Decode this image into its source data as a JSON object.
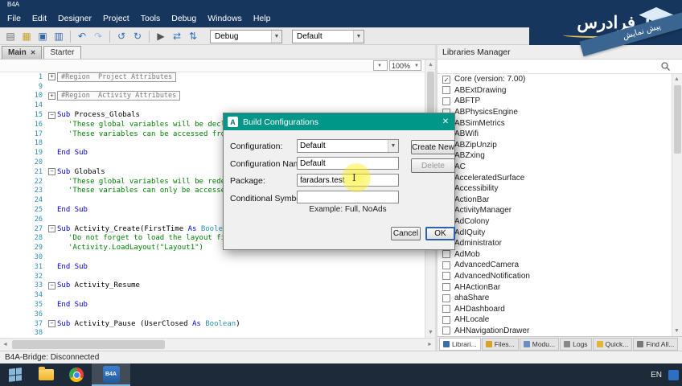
{
  "window": {
    "title": "B4A"
  },
  "menu_bar": {
    "items": [
      "File",
      "Edit",
      "Designer",
      "Project",
      "Tools",
      "Debug",
      "Windows",
      "Help"
    ]
  },
  "toolbar": {
    "build_mode_value": "Debug",
    "config_value": "Default",
    "icons": [
      {
        "name": "new-file-icon",
        "glyph": "▤",
        "color": "#707070"
      },
      {
        "name": "open-project-icon",
        "glyph": "▦",
        "color": "#c9a227"
      },
      {
        "name": "save-icon",
        "glyph": "▣",
        "color": "#3465a4"
      },
      {
        "name": "save-all-icon",
        "glyph": "▥",
        "color": "#3465a4"
      },
      {
        "name": "sep"
      },
      {
        "name": "undo-icon",
        "glyph": "↶",
        "color": "#2e6fb8"
      },
      {
        "name": "redo-icon",
        "glyph": "↷",
        "color": "#9fb8d8"
      },
      {
        "name": "sep"
      },
      {
        "name": "navigate-back-icon",
        "glyph": "↺",
        "color": "#2e6fb8"
      },
      {
        "name": "navigate-forward-icon",
        "glyph": "↻",
        "color": "#2e6fb8"
      },
      {
        "name": "sep"
      },
      {
        "name": "run-icon",
        "glyph": "▶",
        "color": "#555555"
      },
      {
        "name": "compile-icon",
        "glyph": "⇄",
        "color": "#2e6fb8"
      },
      {
        "name": "connect-device-icon",
        "glyph": "⇅",
        "color": "#2e6fb8"
      }
    ]
  },
  "editor_tabs": {
    "tabs": [
      {
        "label": "Main",
        "active": true,
        "closable": true
      },
      {
        "label": "Starter",
        "active": false,
        "closable": false
      }
    ]
  },
  "editor": {
    "zoom_value": "100%",
    "lines": [
      {
        "num": "1",
        "type": "region",
        "fold": "plus",
        "text": "#Region  Project Attributes"
      },
      {
        "num": "9",
        "type": "blank"
      },
      {
        "num": "10",
        "type": "region",
        "fold": "plus",
        "text": "#Region  Activity Attributes"
      },
      {
        "num": "14",
        "type": "blank"
      },
      {
        "num": "15",
        "fold": "minus",
        "segments": [
          {
            "t": "Sub",
            "c": "kw"
          },
          {
            "t": " Process_Globals",
            "c": "plain"
          }
        ]
      },
      {
        "num": "16",
        "indent": 1,
        "segments": [
          {
            "t": "'These global variables will be declared once when the application starts.",
            "c": "comment"
          }
        ]
      },
      {
        "num": "17",
        "indent": 1,
        "segments": [
          {
            "t": "'These variables can be accessed from all modules.",
            "c": "comment"
          }
        ]
      },
      {
        "num": "18",
        "type": "blank"
      },
      {
        "num": "19",
        "segments": [
          {
            "t": "End Sub",
            "c": "kw"
          }
        ]
      },
      {
        "num": "20",
        "type": "blank"
      },
      {
        "num": "21",
        "fold": "minus",
        "segments": [
          {
            "t": "Sub",
            "c": "kw"
          },
          {
            "t": " Globals",
            "c": "plain"
          }
        ]
      },
      {
        "num": "22",
        "indent": 1,
        "segments": [
          {
            "t": "'These global variables will be redeclared each time the activity is created.",
            "c": "comment"
          }
        ]
      },
      {
        "num": "23",
        "indent": 1,
        "segments": [
          {
            "t": "'These variables can only be accessed from this module.",
            "c": "comment"
          }
        ]
      },
      {
        "num": "24",
        "type": "blank"
      },
      {
        "num": "25",
        "segments": [
          {
            "t": "End Sub",
            "c": "kw"
          }
        ]
      },
      {
        "num": "26",
        "type": "blank"
      },
      {
        "num": "27",
        "fold": "minus",
        "segments": [
          {
            "t": "Sub",
            "c": "kw"
          },
          {
            "t": " Activity_Create(FirstTime ",
            "c": "plain"
          },
          {
            "t": "As",
            "c": "kw"
          },
          {
            "t": " ",
            "c": "plain"
          },
          {
            "t": "Boolean",
            "c": "type"
          },
          {
            "t": ")",
            "c": "plain"
          }
        ]
      },
      {
        "num": "28",
        "indent": 1,
        "segments": [
          {
            "t": "'Do not forget to load the layout file created with the visual designer. For example:",
            "c": "comment"
          }
        ]
      },
      {
        "num": "29",
        "indent": 1,
        "segments": [
          {
            "t": "'Activity.LoadLayout(\"Layout1\")",
            "c": "comment"
          }
        ]
      },
      {
        "num": "30",
        "type": "blank"
      },
      {
        "num": "31",
        "segments": [
          {
            "t": "End Sub",
            "c": "kw"
          }
        ]
      },
      {
        "num": "32",
        "type": "blank"
      },
      {
        "num": "33",
        "fold": "minus",
        "segments": [
          {
            "t": "Sub",
            "c": "kw"
          },
          {
            "t": " Activity_Resume",
            "c": "plain"
          }
        ]
      },
      {
        "num": "34",
        "type": "blank"
      },
      {
        "num": "35",
        "segments": [
          {
            "t": "End Sub",
            "c": "kw"
          }
        ]
      },
      {
        "num": "36",
        "type": "blank"
      },
      {
        "num": "37",
        "fold": "minus",
        "segments": [
          {
            "t": "Sub",
            "c": "kw"
          },
          {
            "t": " Activity_Pause (UserClosed ",
            "c": "plain"
          },
          {
            "t": "As",
            "c": "kw"
          },
          {
            "t": " ",
            "c": "plain"
          },
          {
            "t": "Boolean",
            "c": "type"
          },
          {
            "t": ")",
            "c": "plain"
          }
        ]
      },
      {
        "num": "38",
        "type": "blank"
      }
    ]
  },
  "dialog": {
    "title": "Build Configurations",
    "app_icon_letter": "A",
    "fields": {
      "configuration_label": "Configuration:",
      "configuration_value": "Default",
      "configuration_name_label": "Configuration Name:",
      "configuration_name_value": "Default",
      "package_label": "Package:",
      "package_value": "faradars.test",
      "conditional_symbols_label": "Conditional Symbols:",
      "conditional_symbols_value": "",
      "example_text": "Example: Full, NoAds"
    },
    "buttons": {
      "create_new": "Create New",
      "delete": "Delete",
      "cancel": "Cancel",
      "ok": "OK"
    }
  },
  "libraries_panel": {
    "title": "Libraries Manager",
    "items": [
      {
        "label": "Core (version: 7.00)",
        "checked": true
      },
      {
        "label": "ABExtDrawing",
        "checked": false
      },
      {
        "label": "ABFTP",
        "checked": false
      },
      {
        "label": "ABPhysicsEngine",
        "checked": false
      },
      {
        "label": "ABSimMetrics",
        "checked": false
      },
      {
        "label": "ABWifi",
        "checked": false
      },
      {
        "label": "ABZipUnzip",
        "checked": false
      },
      {
        "label": "ABZxing",
        "checked": false
      },
      {
        "label": "AC",
        "checked": false
      },
      {
        "label": "AcceleratedSurface",
        "checked": false
      },
      {
        "label": "Accessibility",
        "checked": false
      },
      {
        "label": "ActionBar",
        "checked": false
      },
      {
        "label": "ActivityManager",
        "checked": false
      },
      {
        "label": "AdColony",
        "checked": false
      },
      {
        "label": "AdIQuity",
        "checked": false
      },
      {
        "label": "Administrator",
        "checked": false
      },
      {
        "label": "AdMob",
        "checked": false
      },
      {
        "label": "AdvancedCamera",
        "checked": false
      },
      {
        "label": "AdvancedNotification",
        "checked": false
      },
      {
        "label": "AHActionBar",
        "checked": false
      },
      {
        "label": "ahaShare",
        "checked": false
      },
      {
        "label": "AHDashboard",
        "checked": false
      },
      {
        "label": "AHLocale",
        "checked": false
      },
      {
        "label": "AHNavigationDrawer",
        "checked": false
      }
    ]
  },
  "bottom_tabs": {
    "tabs": [
      {
        "label": "Librari...",
        "icon": "libraries-icon",
        "color": "#3a6ea5",
        "active": true
      },
      {
        "label": "Files...",
        "icon": "files-icon",
        "color": "#d8a22a",
        "active": false
      },
      {
        "label": "Modu...",
        "icon": "modules-icon",
        "color": "#6a8fc0",
        "active": false
      },
      {
        "label": "Logs",
        "icon": "logs-icon",
        "color": "#888888",
        "active": false
      },
      {
        "label": "Quick...",
        "icon": "quick-icon",
        "color": "#e0b63c",
        "active": false
      },
      {
        "label": "Find All...",
        "icon": "find-icon",
        "color": "#777777",
        "active": false
      }
    ]
  },
  "status_bar": {
    "text": "B4A-Bridge: Disconnected"
  },
  "taskbar": {
    "b4a_label": "B4A",
    "language": "EN"
  },
  "branding": {
    "logo_text": "فرادرس",
    "ribbon_text": "پیش نمایش"
  },
  "colors": {
    "titlebar": "#17365d",
    "dialog_title": "#009688",
    "comment": "#008000",
    "keyword": "#0000e6",
    "type": "#2b91af",
    "taskbar": "#1d2a39"
  }
}
